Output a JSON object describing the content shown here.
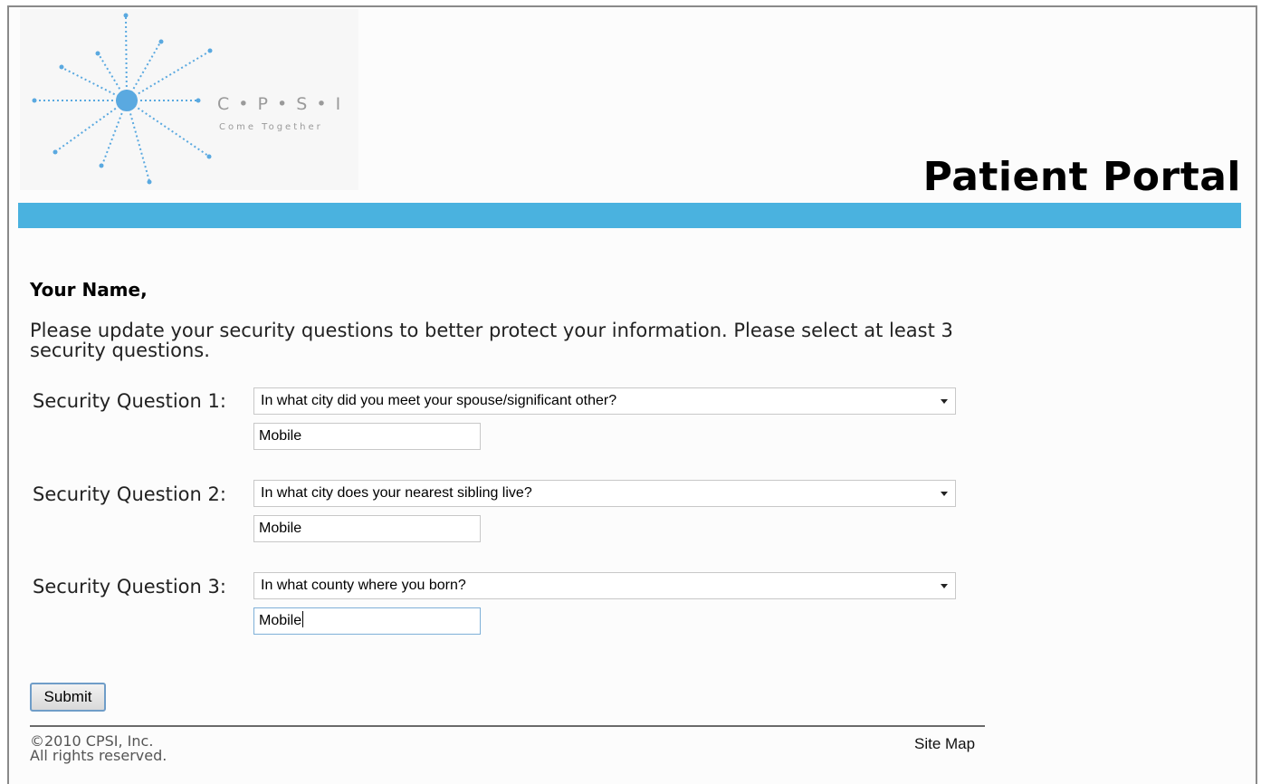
{
  "header": {
    "logo": {
      "name": "C • P • S • I",
      "tagline": "Come Together"
    },
    "title": "Patient Portal"
  },
  "accent_color": "#4ab2df",
  "greeting": "Your Name,",
  "intro": "Please update your security questions to better protect your information. Please select at least 3 security questions.",
  "questions": [
    {
      "label": "Security Question 1:",
      "selected": "In what city did you meet your spouse/significant other?",
      "answer": "Mobile"
    },
    {
      "label": "Security Question 2:",
      "selected": "In what city does your nearest sibling live?",
      "answer": "Mobile"
    },
    {
      "label": "Security Question 3:",
      "selected": "In what county where you born?",
      "answer": "Mobile"
    }
  ],
  "submit_label": "Submit",
  "footer": {
    "copyright_line1": "©2010 CPSI, Inc.",
    "copyright_line2": "All rights reserved.",
    "site_map": "Site Map"
  }
}
